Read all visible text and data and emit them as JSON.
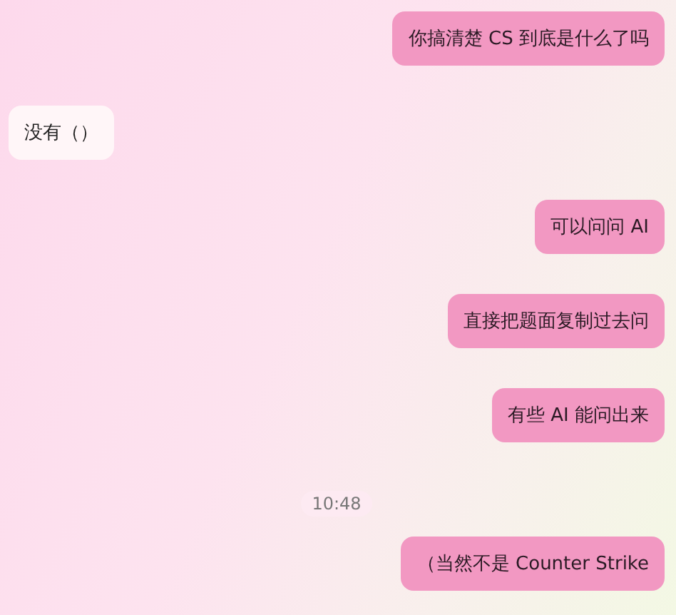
{
  "messages": [
    {
      "kind": "sent",
      "text": "你搞清楚 CS 到底是什么了吗"
    },
    {
      "kind": "received",
      "text": "没有（）"
    },
    {
      "kind": "sent",
      "text": "可以问问 AI"
    },
    {
      "kind": "sent",
      "text": "直接把题面复制过去问"
    },
    {
      "kind": "sent",
      "text": "有些 AI 能问出来"
    },
    {
      "kind": "time",
      "text": "10:48"
    },
    {
      "kind": "sent",
      "text": "（当然不是 Counter Strike"
    }
  ]
}
